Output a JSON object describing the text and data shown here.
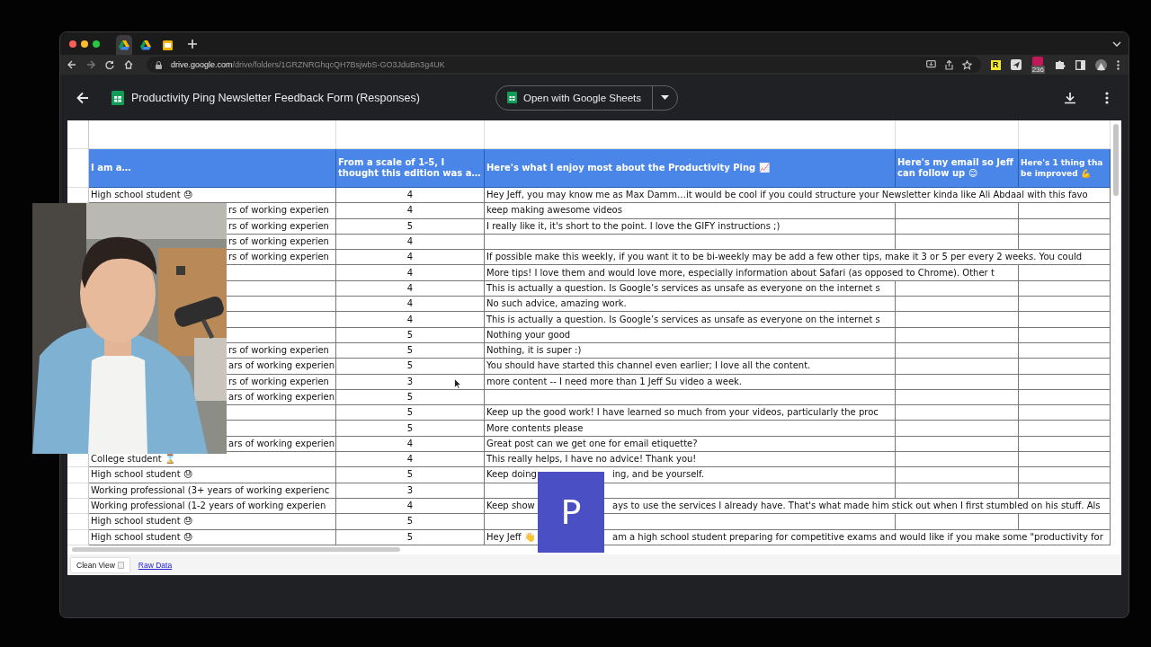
{
  "browser": {
    "tabs": [
      {
        "kind": "drive",
        "selected": true
      },
      {
        "kind": "drive",
        "selected": false
      },
      {
        "kind": "slides",
        "selected": false
      }
    ],
    "url_domain": "drive.google.com",
    "url_path": "/drive/folders/1GRZNRGhqcQH7BsjwbS-GO3JduBn3g4UK",
    "extension_letter": "R",
    "extension_badge": "236"
  },
  "header": {
    "title": "Productivity Ping Newsletter Feedback Form (Responses)",
    "open_button": "Open with Google Sheets"
  },
  "sheet": {
    "columns": [
      "I am a…",
      "From a scale of 1-5, I thought this edition was a…",
      "Here's what I enjoy most about the Productivity Ping 📈",
      "Here's my email so Jeff can follow up 😊",
      "Here's 1 thing tha\nbe improved 💪"
    ],
    "rows": [
      {
        "a": "High school student 😓",
        "a_covered": false,
        "b": "4",
        "c": "Hey Jeff, you may know me as Max Damm…it would be cool if you could structure your Newsletter kinda like Ali Abdaal with this favo",
        "c_spill": true
      },
      {
        "a": "rs of working experien",
        "a_covered": true,
        "b": "4",
        "c": "keep making awesome videos",
        "c_spill": false
      },
      {
        "a": "rs of working experien",
        "a_covered": true,
        "b": "5",
        "c": "I really like it, it's short to the point. I love the GIFY instructions ;)",
        "c_spill": false
      },
      {
        "a": "rs of working experien",
        "a_covered": true,
        "b": "4",
        "c_spill": false
      },
      {
        "a": "rs of working experien",
        "a_covered": true,
        "b": "4",
        "c": "If possible make this weekly, if you want it to be bi-weekly may be add a few other tips, make it 3 or 5 per every 2 weeks. You could",
        "c_spill": true
      },
      {
        "b": "4",
        "c": "More tips! I love them and would love more, especially information about Safari (as opposed to Chrome). Other t",
        "c_spill": false,
        "c_into_email": true
      },
      {
        "b": "4",
        "c": "This is actually a question. Is Google’s services as unsafe as everyone on the internet s",
        "c_spill": false
      },
      {
        "b": "4",
        "c": "No such advice, amazing work.",
        "c_spill": false
      },
      {
        "b": "4",
        "c": "This is actually a question. Is Google’s services as unsafe as everyone on the internet s",
        "c_spill": false
      },
      {
        "b": "5",
        "c": "Nothing your good",
        "c_spill": false
      },
      {
        "a": "rs of working experien",
        "a_covered": true,
        "b": "5",
        "c": "Nothing, it is super :)",
        "c_spill": false
      },
      {
        "a": "ars of working experien",
        "a_covered": true,
        "b": "5",
        "c": "You should have started this channel even earlier; I love all the content.",
        "c_spill": false
      },
      {
        "a": "rs of working experien",
        "a_covered": true,
        "b": "3",
        "c": "more content -- I need more than 1 Jeff Su video a week.",
        "c_spill": false
      },
      {
        "a": "ars of working experien",
        "a_covered": true,
        "b": "5",
        "c_spill": false
      },
      {
        "b": "5",
        "c": "Keep up the good work! I have learned so much from your videos, particularly the proc",
        "c_spill": false
      },
      {
        "b": "5",
        "c": "More contents please",
        "c_spill": false
      },
      {
        "a": "ars of working experien",
        "a_covered": true,
        "b": "4",
        "c": "Great post can we get one for email etiquette?",
        "c_spill": false
      },
      {
        "a": "College student ⌛",
        "a_covered": false,
        "b": "4",
        "c": "This really helps, I have no advice! Thank you!",
        "c_spill": false
      },
      {
        "a": "High school student 😓",
        "a_covered": false,
        "b": "5",
        "c": "Keep doing",
        "c_rest": "ing, and be yourself.",
        "c_spill": false
      },
      {
        "a": "Working professional (3+ years of working experienc",
        "a_covered": false,
        "b": "3",
        "c_spill": false
      },
      {
        "a": "Working professional (1-2 years of working experien",
        "a_covered": false,
        "b": "4",
        "c": "Keep show",
        "c_rest": "ays to use the services I already have. That's what made him stick out when I first stumbled on his stuff. Als",
        "c_spill": true
      },
      {
        "a": "High school student 😓",
        "a_covered": false,
        "b": "5",
        "c_spill": false
      },
      {
        "a": "High school student 😓",
        "a_covered": false,
        "b": "5",
        "c": "Hey Jeff 👋",
        "c_rest": "am a high school student preparing for competitive exams and would like if you make some \"productivity for",
        "c_spill": true
      }
    ],
    "sheet_tabs": [
      {
        "label": "Clean View",
        "selected": true
      },
      {
        "label": "Raw Data",
        "selected": false
      }
    ]
  },
  "overlay_badge": "P"
}
